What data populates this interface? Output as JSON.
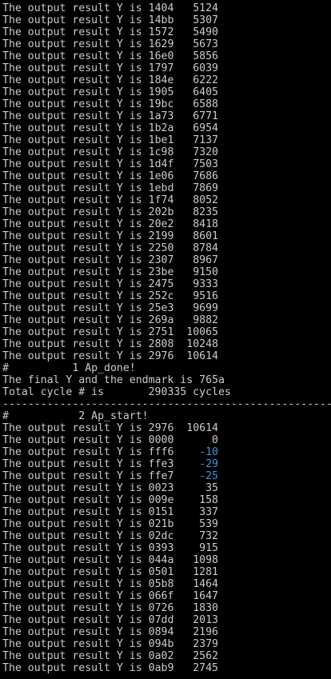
{
  "colors": {
    "background": "#000000",
    "foreground": "#cccccc",
    "negative_value": "#3a96dd"
  },
  "block1": {
    "rows": [
      {
        "prefix": "The output result Y is ",
        "hex": "1404",
        "dec": "5124"
      },
      {
        "prefix": "The output result Y is ",
        "hex": "14bb",
        "dec": "5307"
      },
      {
        "prefix": "The output result Y is ",
        "hex": "1572",
        "dec": "5490"
      },
      {
        "prefix": "The output result Y is ",
        "hex": "1629",
        "dec": "5673"
      },
      {
        "prefix": "The output result Y is ",
        "hex": "16e0",
        "dec": "5856"
      },
      {
        "prefix": "The output result Y is ",
        "hex": "1797",
        "dec": "6039"
      },
      {
        "prefix": "The output result Y is ",
        "hex": "184e",
        "dec": "6222"
      },
      {
        "prefix": "The output result Y is ",
        "hex": "1905",
        "dec": "6405"
      },
      {
        "prefix": "The output result Y is ",
        "hex": "19bc",
        "dec": "6588"
      },
      {
        "prefix": "The output result Y is ",
        "hex": "1a73",
        "dec": "6771"
      },
      {
        "prefix": "The output result Y is ",
        "hex": "1b2a",
        "dec": "6954"
      },
      {
        "prefix": "The output result Y is ",
        "hex": "1be1",
        "dec": "7137"
      },
      {
        "prefix": "The output result Y is ",
        "hex": "1c98",
        "dec": "7320"
      },
      {
        "prefix": "The output result Y is ",
        "hex": "1d4f",
        "dec": "7503"
      },
      {
        "prefix": "The output result Y is ",
        "hex": "1e06",
        "dec": "7686"
      },
      {
        "prefix": "The output result Y is ",
        "hex": "1ebd",
        "dec": "7869"
      },
      {
        "prefix": "The output result Y is ",
        "hex": "1f74",
        "dec": "8052"
      },
      {
        "prefix": "The output result Y is ",
        "hex": "202b",
        "dec": "8235"
      },
      {
        "prefix": "The output result Y is ",
        "hex": "20e2",
        "dec": "8418"
      },
      {
        "prefix": "The output result Y is ",
        "hex": "2199",
        "dec": "8601"
      },
      {
        "prefix": "The output result Y is ",
        "hex": "2250",
        "dec": "8784"
      },
      {
        "prefix": "The output result Y is ",
        "hex": "2307",
        "dec": "8967"
      },
      {
        "prefix": "The output result Y is ",
        "hex": "23be",
        "dec": "9150"
      },
      {
        "prefix": "The output result Y is ",
        "hex": "2475",
        "dec": "9333"
      },
      {
        "prefix": "The output result Y is ",
        "hex": "252c",
        "dec": "9516"
      },
      {
        "prefix": "The output result Y is ",
        "hex": "25e3",
        "dec": "9699"
      },
      {
        "prefix": "The output result Y is ",
        "hex": "269a",
        "dec": "9882"
      },
      {
        "prefix": "The output result Y is ",
        "hex": "2751",
        "dec": "10065"
      },
      {
        "prefix": "The output result Y is ",
        "hex": "2808",
        "dec": "10248"
      },
      {
        "prefix": "The output result Y is ",
        "hex": "2976",
        "dec": "10614"
      }
    ],
    "done_line": "#          1 Ap_done!",
    "final_line": "The final Y and the endmark is 765a",
    "cycle_line": "Total cycle # is       290335 cycles",
    "separator": "---------------------------------------------------------"
  },
  "block2": {
    "start_line": "#           2 Ap_start!",
    "rows": [
      {
        "prefix": "The output result Y is ",
        "hex": "2976",
        "dec": "10614",
        "negative": false
      },
      {
        "prefix": "The output result Y is ",
        "hex": "0000",
        "dec": "0",
        "negative": false
      },
      {
        "prefix": "The output result Y is ",
        "hex": "fff6",
        "dec": "-10",
        "negative": true
      },
      {
        "prefix": "The output result Y is ",
        "hex": "ffe3",
        "dec": "-29",
        "negative": true
      },
      {
        "prefix": "The output result Y is ",
        "hex": "ffe7",
        "dec": "-25",
        "negative": true
      },
      {
        "prefix": "The output result Y is ",
        "hex": "0023",
        "dec": "35",
        "negative": false
      },
      {
        "prefix": "The output result Y is ",
        "hex": "009e",
        "dec": "158",
        "negative": false
      },
      {
        "prefix": "The output result Y is ",
        "hex": "0151",
        "dec": "337",
        "negative": false
      },
      {
        "prefix": "The output result Y is ",
        "hex": "021b",
        "dec": "539",
        "negative": false
      },
      {
        "prefix": "The output result Y is ",
        "hex": "02dc",
        "dec": "732",
        "negative": false
      },
      {
        "prefix": "The output result Y is ",
        "hex": "0393",
        "dec": "915",
        "negative": false
      },
      {
        "prefix": "The output result Y is ",
        "hex": "044a",
        "dec": "1098",
        "negative": false
      },
      {
        "prefix": "The output result Y is ",
        "hex": "0501",
        "dec": "1281",
        "negative": false
      },
      {
        "prefix": "The output result Y is ",
        "hex": "05b8",
        "dec": "1464",
        "negative": false
      },
      {
        "prefix": "The output result Y is ",
        "hex": "066f",
        "dec": "1647",
        "negative": false
      },
      {
        "prefix": "The output result Y is ",
        "hex": "0726",
        "dec": "1830",
        "negative": false
      },
      {
        "prefix": "The output result Y is ",
        "hex": "07dd",
        "dec": "2013",
        "negative": false
      },
      {
        "prefix": "The output result Y is ",
        "hex": "0894",
        "dec": "2196",
        "negative": false
      },
      {
        "prefix": "The output result Y is ",
        "hex": "094b",
        "dec": "2379",
        "negative": false
      },
      {
        "prefix": "The output result Y is ",
        "hex": "0a02",
        "dec": "2562",
        "negative": false
      },
      {
        "prefix": "The output result Y is ",
        "hex": "0ab9",
        "dec": "2745",
        "negative": false
      }
    ]
  }
}
